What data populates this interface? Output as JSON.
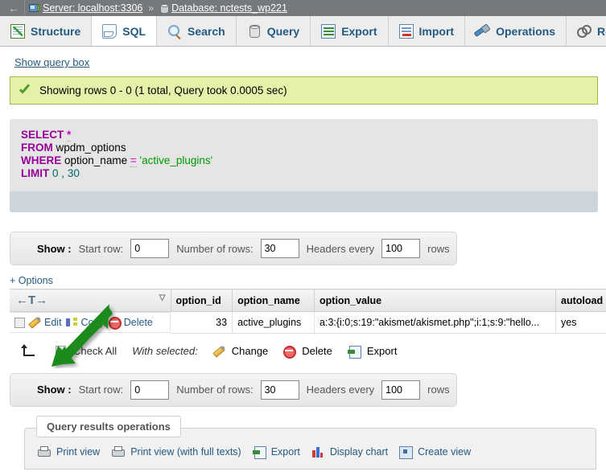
{
  "breadcrumb": {
    "back_label": "←",
    "server": {
      "icon": "server-icon",
      "label": "Server: localhost:3306"
    },
    "separator": "»",
    "database": {
      "icon": "database-icon",
      "label": "Database: nctests_wp221"
    }
  },
  "tabs": [
    {
      "label": "Structure",
      "icon": "structure-icon",
      "active": false
    },
    {
      "label": "SQL",
      "icon": "sql-icon",
      "active": true
    },
    {
      "label": "Search",
      "icon": "search-icon",
      "active": false
    },
    {
      "label": "Query",
      "icon": "query-icon",
      "active": false
    },
    {
      "label": "Export",
      "icon": "export-icon",
      "active": false
    },
    {
      "label": "Import",
      "icon": "import-icon",
      "active": false
    },
    {
      "label": "Operations",
      "icon": "operations-icon",
      "active": false
    },
    {
      "label": "Routines",
      "icon": "routines-icon",
      "active": false
    }
  ],
  "show_query_box_label": "Show query box",
  "notice": {
    "icon": "green-check-icon",
    "text": "Showing rows 0 - 0 (1 total, Query took 0.0005 sec)"
  },
  "sql": {
    "line1_kw": "SELECT",
    "line1_star": "*",
    "line2_kw": "FROM",
    "line2_table": "wpdm_options",
    "line3_kw": "WHERE",
    "line3_col": "option_name",
    "line3_op": "=",
    "line3_val": "'active_plugins'",
    "line4_kw": "LIMIT",
    "line4_start": "0",
    "line4_comma": ",",
    "line4_count": "30"
  },
  "show_bar": {
    "show_label": "Show :",
    "start_row_label": "Start row:",
    "start_row_value": "0",
    "num_rows_label": "Number of rows:",
    "num_rows_value": "30",
    "headers_label": "Headers every",
    "headers_value": "100",
    "rows_label": "rows"
  },
  "options_link": "+ Options",
  "table": {
    "nav_header": "←T→",
    "sort_caret": "▽",
    "columns": [
      "option_id",
      "option_name",
      "option_value",
      "autoload"
    ],
    "row_actions": {
      "edit": "Edit",
      "copy": "Copy",
      "delete": "Delete"
    },
    "rows": [
      {
        "option_id": "33",
        "option_name": "active_plugins",
        "option_value": "a:3:{i:0;s:19:\"akismet/akismet.php\";i:1;s:9:\"hello...",
        "autoload": "yes"
      }
    ]
  },
  "with_selected": {
    "check_all_label": "Check All",
    "with_selected_label": "With selected:",
    "change_label": "Change",
    "delete_label": "Delete",
    "export_label": "Export"
  },
  "query_results_operations": {
    "legend": "Query results operations",
    "items": [
      {
        "label": "Print view",
        "icon": "printer-icon"
      },
      {
        "label": "Print view (with full texts)",
        "icon": "printer-icon"
      },
      {
        "label": "Export",
        "icon": "export-icon"
      },
      {
        "label": "Display chart",
        "icon": "bar-chart-icon"
      },
      {
        "label": "Create view",
        "icon": "create-view-icon"
      }
    ]
  },
  "annotation": {
    "type": "green-arrow",
    "color": "#1f8a1f",
    "points_to": "edit-link"
  }
}
